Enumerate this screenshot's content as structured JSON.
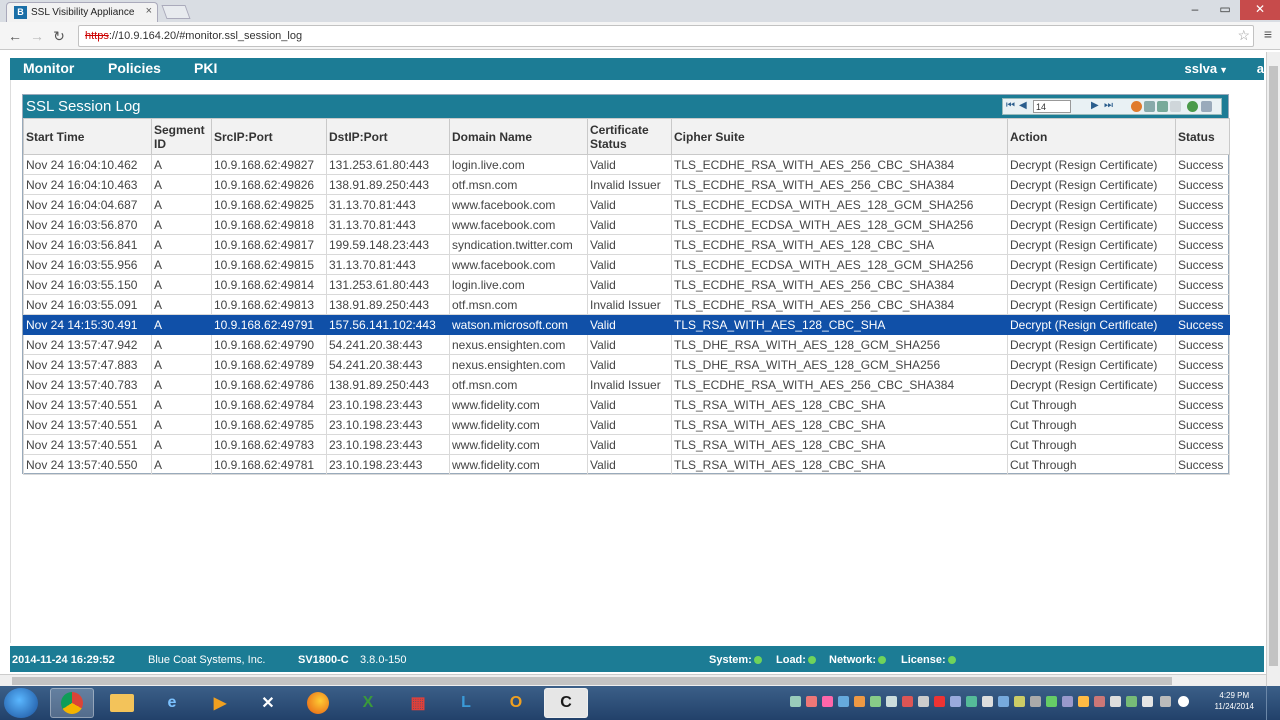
{
  "browser": {
    "tab_title": "SSL Visibility Appliance",
    "tab_favicon_letter": "B",
    "close_glyph": "×",
    "url_protocol": "https",
    "url_rest": "://10.9.164.20/#monitor.ssl_session_log",
    "icons": [
      "back-icon",
      "forward-icon",
      "reload-icon",
      "star-icon",
      "menu-icon"
    ]
  },
  "nav": {
    "items": [
      "Monitor",
      "Policies",
      "PKI"
    ],
    "user": "sslva",
    "edge_letter": "a"
  },
  "panel": {
    "title": "SSL Session Log",
    "page_value": "14"
  },
  "table": {
    "columns": [
      "Start Time",
      "Segment ID",
      "SrcIP:Port",
      "DstIP:Port",
      "Domain Name",
      "Certificate Status",
      "Cipher Suite",
      "Action",
      "Status"
    ],
    "rows": [
      [
        "Nov 24 16:04:10.462",
        "A",
        "10.9.168.62:49827",
        "131.253.61.80:443",
        "login.live.com",
        "Valid",
        "TLS_ECDHE_RSA_WITH_AES_256_CBC_SHA384",
        "Decrypt (Resign Certificate)",
        "Success"
      ],
      [
        "Nov 24 16:04:10.463",
        "A",
        "10.9.168.62:49826",
        "138.91.89.250:443",
        "otf.msn.com",
        "Invalid Issuer",
        "TLS_ECDHE_RSA_WITH_AES_256_CBC_SHA384",
        "Decrypt (Resign Certificate)",
        "Success"
      ],
      [
        "Nov 24 16:04:04.687",
        "A",
        "10.9.168.62:49825",
        "31.13.70.81:443",
        "www.facebook.com",
        "Valid",
        "TLS_ECDHE_ECDSA_WITH_AES_128_GCM_SHA256",
        "Decrypt (Resign Certificate)",
        "Success"
      ],
      [
        "Nov 24 16:03:56.870",
        "A",
        "10.9.168.62:49818",
        "31.13.70.81:443",
        "www.facebook.com",
        "Valid",
        "TLS_ECDHE_ECDSA_WITH_AES_128_GCM_SHA256",
        "Decrypt (Resign Certificate)",
        "Success"
      ],
      [
        "Nov 24 16:03:56.841",
        "A",
        "10.9.168.62:49817",
        "199.59.148.23:443",
        "syndication.twitter.com",
        "Valid",
        "TLS_ECDHE_RSA_WITH_AES_128_CBC_SHA",
        "Decrypt (Resign Certificate)",
        "Success"
      ],
      [
        "Nov 24 16:03:55.956",
        "A",
        "10.9.168.62:49815",
        "31.13.70.81:443",
        "www.facebook.com",
        "Valid",
        "TLS_ECDHE_ECDSA_WITH_AES_128_GCM_SHA256",
        "Decrypt (Resign Certificate)",
        "Success"
      ],
      [
        "Nov 24 16:03:55.150",
        "A",
        "10.9.168.62:49814",
        "131.253.61.80:443",
        "login.live.com",
        "Valid",
        "TLS_ECDHE_RSA_WITH_AES_256_CBC_SHA384",
        "Decrypt (Resign Certificate)",
        "Success"
      ],
      [
        "Nov 24 16:03:55.091",
        "A",
        "10.9.168.62:49813",
        "138.91.89.250:443",
        "otf.msn.com",
        "Invalid Issuer",
        "TLS_ECDHE_RSA_WITH_AES_256_CBC_SHA384",
        "Decrypt (Resign Certificate)",
        "Success"
      ],
      [
        "Nov 24 14:15:30.491",
        "A",
        "10.9.168.62:49791",
        "157.56.141.102:443",
        "watson.microsoft.com",
        "Valid",
        "TLS_RSA_WITH_AES_128_CBC_SHA",
        "Decrypt (Resign Certificate)",
        "Success"
      ],
      [
        "Nov 24 13:57:47.942",
        "A",
        "10.9.168.62:49790",
        "54.241.20.38:443",
        "nexus.ensighten.com",
        "Valid",
        "TLS_DHE_RSA_WITH_AES_128_GCM_SHA256",
        "Decrypt (Resign Certificate)",
        "Success"
      ],
      [
        "Nov 24 13:57:47.883",
        "A",
        "10.9.168.62:49789",
        "54.241.20.38:443",
        "nexus.ensighten.com",
        "Valid",
        "TLS_DHE_RSA_WITH_AES_128_GCM_SHA256",
        "Decrypt (Resign Certificate)",
        "Success"
      ],
      [
        "Nov 24 13:57:40.783",
        "A",
        "10.9.168.62:49786",
        "138.91.89.250:443",
        "otf.msn.com",
        "Invalid Issuer",
        "TLS_ECDHE_RSA_WITH_AES_256_CBC_SHA384",
        "Decrypt (Resign Certificate)",
        "Success"
      ],
      [
        "Nov 24 13:57:40.551",
        "A",
        "10.9.168.62:49784",
        "23.10.198.23:443",
        "www.fidelity.com",
        "Valid",
        "TLS_RSA_WITH_AES_128_CBC_SHA",
        "Cut Through",
        "Success"
      ],
      [
        "Nov 24 13:57:40.551",
        "A",
        "10.9.168.62:49785",
        "23.10.198.23:443",
        "www.fidelity.com",
        "Valid",
        "TLS_RSA_WITH_AES_128_CBC_SHA",
        "Cut Through",
        "Success"
      ],
      [
        "Nov 24 13:57:40.551",
        "A",
        "10.9.168.62:49783",
        "23.10.198.23:443",
        "www.fidelity.com",
        "Valid",
        "TLS_RSA_WITH_AES_128_CBC_SHA",
        "Cut Through",
        "Success"
      ],
      [
        "Nov 24 13:57:40.550",
        "A",
        "10.9.168.62:49781",
        "23.10.198.23:443",
        "www.fidelity.com",
        "Valid",
        "TLS_RSA_WITH_AES_128_CBC_SHA",
        "Cut Through",
        "Success"
      ]
    ],
    "selected_row": 8
  },
  "footer": {
    "datetime": "2014-11-24 16:29:52",
    "company": "Blue Coat Systems, Inc.",
    "model": "SV1800-C",
    "version": "3.8.0-150",
    "system_label": "System:",
    "load_label": "Load:",
    "network_label": "Network:",
    "license_label": "License:",
    "status_color": "#6fd35b"
  },
  "taskbar": {
    "clock_time": "4:29 PM",
    "clock_date": "11/24/2014"
  },
  "colors": {
    "brand_teal": "#1c7c95",
    "selection_blue": "#1050a8"
  }
}
